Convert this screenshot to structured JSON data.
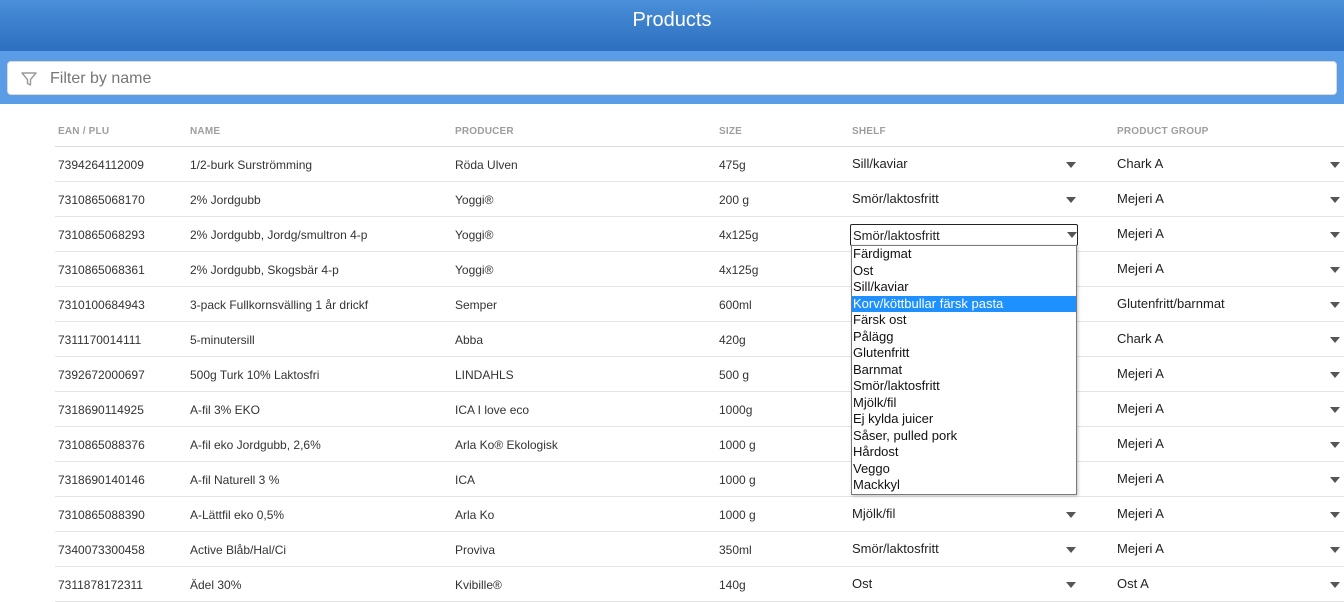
{
  "header": {
    "title": "Products"
  },
  "filter": {
    "placeholder": "Filter by name",
    "icon": "funnel-icon"
  },
  "columns": {
    "ean": "EAN / PLU",
    "name": "NAME",
    "producer": "PRODUCER",
    "size": "SIZE",
    "shelf": "SHELF",
    "group": "PRODUCT GROUP"
  },
  "rows": [
    {
      "ean": "7394264112009",
      "name": "1/2-burk Surströmming",
      "producer": "Röda Ulven",
      "size": "475g",
      "shelf": "Sill/kaviar",
      "group": "Chark A"
    },
    {
      "ean": "7310865068170",
      "name": "2% Jordgubb",
      "producer": "Yoggi®",
      "size": "200 g",
      "shelf": "Smör/laktosfritt",
      "group": "Mejeri A"
    },
    {
      "ean": "7310865068293",
      "name": "2% Jordgubb, Jordg/smultron 4-p",
      "producer": "Yoggi®",
      "size": "4x125g",
      "shelf": "Smör/laktosfritt",
      "group": "Mejeri A"
    },
    {
      "ean": "7310865068361",
      "name": "2% Jordgubb, Skogsbär 4-p",
      "producer": "Yoggi®",
      "size": "4x125g",
      "shelf": "",
      "group": "Mejeri A"
    },
    {
      "ean": "7310100684943",
      "name": "3-pack Fullkornsvälling 1 år drickf",
      "producer": "Semper",
      "size": "600ml",
      "shelf": "",
      "group": "Glutenfritt/barnmat"
    },
    {
      "ean": "7311170014111",
      "name": "5-minutersill",
      "producer": "Abba",
      "size": "420g",
      "shelf": "",
      "group": "Chark A"
    },
    {
      "ean": "7392672000697",
      "name": "500g Turk 10% Laktosfri",
      "producer": "LINDAHLS",
      "size": "500 g",
      "shelf": "",
      "group": "Mejeri A"
    },
    {
      "ean": "7318690114925",
      "name": "A-fil 3% EKO",
      "producer": "ICA I love eco",
      "size": "1000g",
      "shelf": "",
      "group": "Mejeri A"
    },
    {
      "ean": "7310865088376",
      "name": "A-fil eko Jordgubb, 2,6%",
      "producer": "Arla Ko® Ekologisk",
      "size": "1000 g",
      "shelf": "",
      "group": "Mejeri A"
    },
    {
      "ean": "7318690140146",
      "name": "A-fil Naturell 3 %",
      "producer": "ICA",
      "size": "1000 g",
      "shelf": "",
      "group": "Mejeri A"
    },
    {
      "ean": "7310865088390",
      "name": "A-Lättfil eko 0,5%",
      "producer": "Arla Ko",
      "size": "1000 g",
      "shelf": "Mjölk/fil",
      "group": "Mejeri A"
    },
    {
      "ean": "7340073300458",
      "name": "Active Blåb/Hal/Ci",
      "producer": "Proviva",
      "size": "350ml",
      "shelf": "Smör/laktosfritt",
      "group": "Mejeri A"
    },
    {
      "ean": "7311878172311",
      "name": "Ädel 30%",
      "producer": "Kvibille®",
      "size": "140g",
      "shelf": "Ost",
      "group": "Ost A"
    }
  ],
  "open_select": {
    "value": "Smör/laktosfritt",
    "options": [
      "Färdigmat",
      "Ost",
      "Sill/kaviar",
      "Korv/köttbullar färsk pasta",
      "Färsk ost",
      "Pålägg",
      "Glutenfritt",
      "Barnmat",
      "Smör/laktosfritt",
      "Mjölk/fil",
      "Ej kylda juicer",
      "Såser, pulled pork",
      "Hårdost",
      "Veggo",
      "Mackkyl"
    ],
    "highlighted": "Korv/köttbullar färsk pasta"
  },
  "colors": {
    "header_bg": "#2c6fc0",
    "filter_band_bg": "#5a9ce6",
    "highlight": "#1e90ff"
  }
}
